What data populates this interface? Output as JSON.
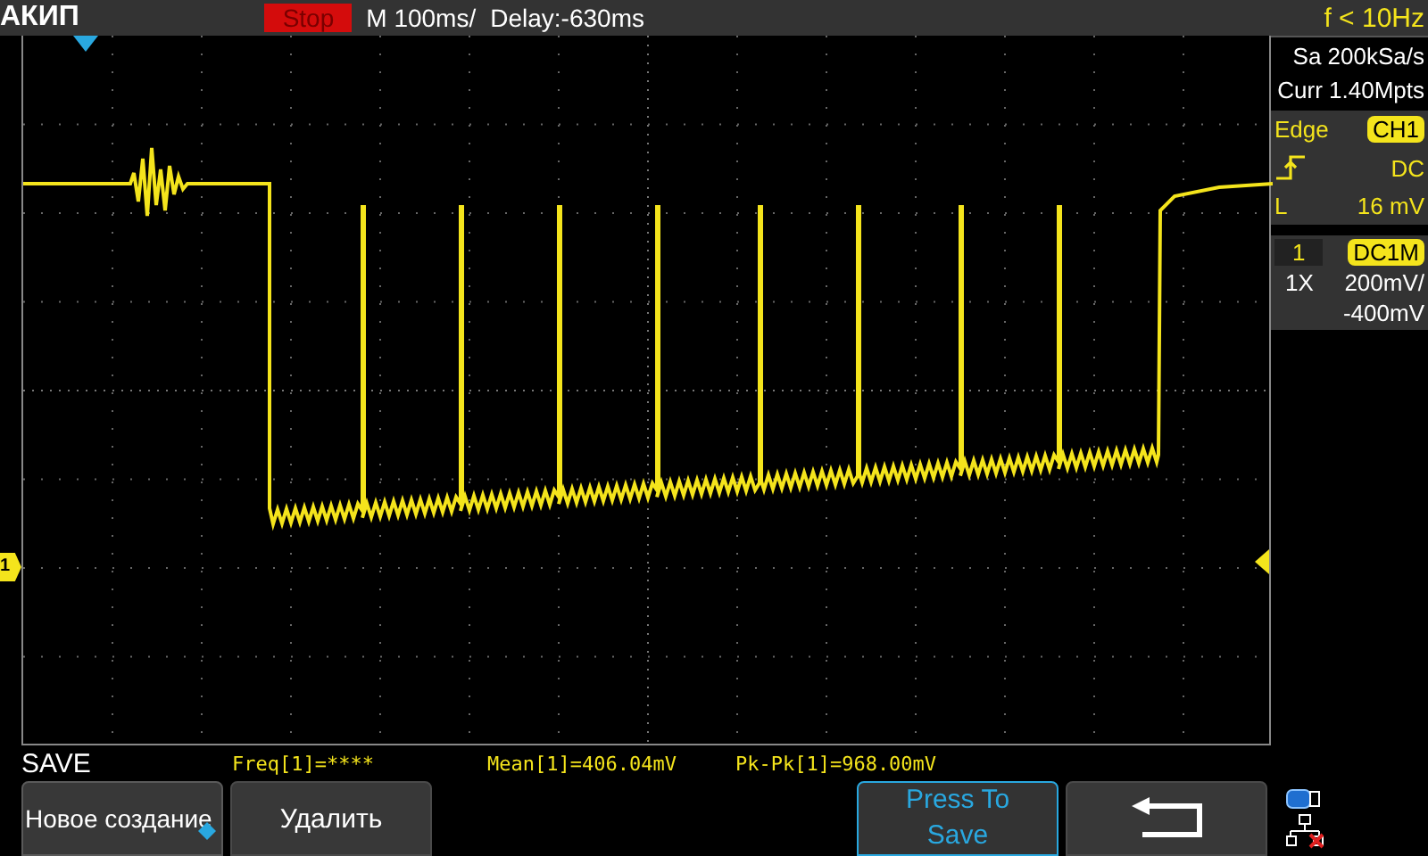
{
  "header": {
    "brand": "АКИП",
    "run_state": "Stop",
    "timebase": "M 100ms/",
    "delay": "Delay:-630ms",
    "frequency": "f < 10Hz"
  },
  "acquisition": {
    "sample_rate": "Sa 200kSa/s",
    "memory": "Curr 1.40Mpts"
  },
  "trigger": {
    "type": "Edge",
    "source": "CH1",
    "coupling": "DC",
    "level_label": "L",
    "level_value": "16 mV"
  },
  "channel": {
    "number": "1",
    "coupling": "DC1M",
    "probe": "1X",
    "scale": "200mV/",
    "offset": "-400mV"
  },
  "channel_marker": "1",
  "menu_title": "SAVE",
  "measurements": [
    "Freq[1]=****",
    "Mean[1]=406.04mV",
    "Pk-Pk[1]=968.00mV"
  ],
  "softkeys": [
    {
      "kind": "text",
      "label": "Новое создание",
      "selected": true
    },
    {
      "kind": "text",
      "label": "Удалить",
      "selected": false
    },
    {
      "kind": "empty"
    },
    {
      "kind": "empty"
    },
    {
      "kind": "highlight",
      "label": "Press To Save"
    },
    {
      "kind": "back"
    }
  ]
}
